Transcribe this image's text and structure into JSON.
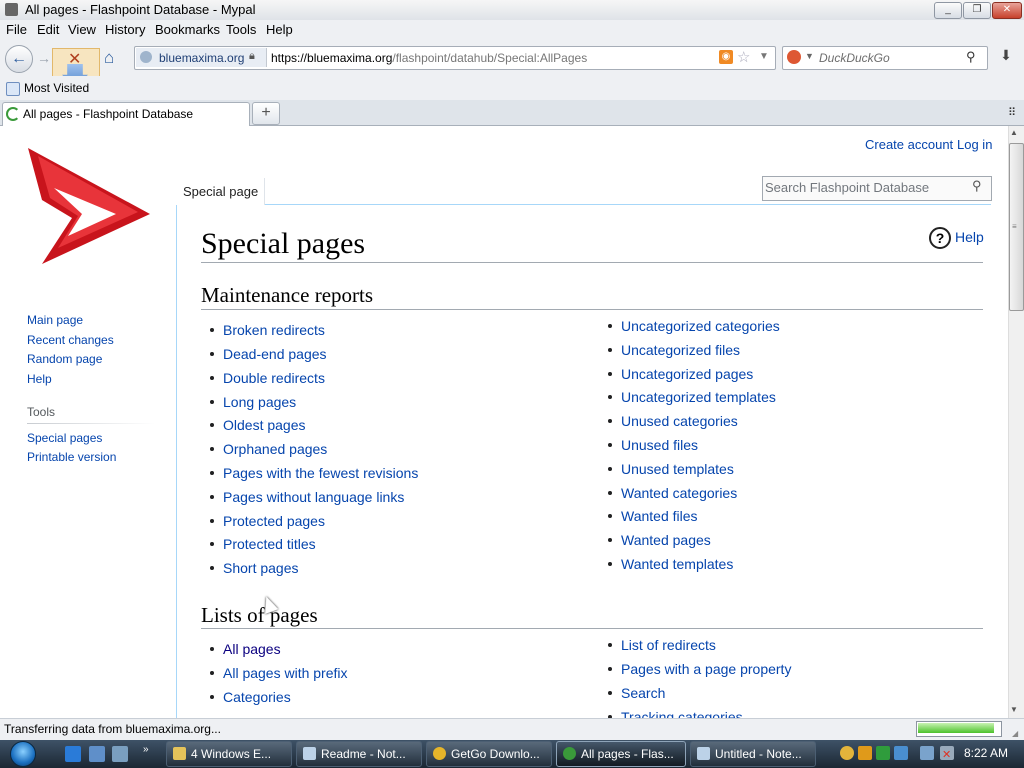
{
  "window": {
    "title": "All pages - Flashpoint Database - Mypal",
    "controls": [
      "_",
      "❐",
      "✕"
    ]
  },
  "menu": [
    "File",
    "Edit",
    "View",
    "History",
    "Bookmarks",
    "Tools",
    "Help"
  ],
  "navbar": {
    "site_identity": "bluemaxima.org",
    "url_host": "https://bluemaxima.org",
    "url_path": "/flashpoint/datahub/Special:AllPages",
    "search_placeholder": "DuckDuckGo"
  },
  "bookmarks": {
    "most_visited": "Most Visited"
  },
  "tabs": {
    "active_label": "All pages - Flashpoint Database",
    "new_tab": "+"
  },
  "page": {
    "personal": {
      "create_account": "Create account",
      "log_in": "Log in"
    },
    "tab_special": "Special page",
    "search_placeholder": "Search Flashpoint Database",
    "heading": "Special pages",
    "help": "Help",
    "sidebar": {
      "nav": [
        "Main page",
        "Recent changes",
        "Random page",
        "Help"
      ],
      "tools_heading": "Tools",
      "tools": [
        "Special pages",
        "Printable version"
      ]
    },
    "maintenance": {
      "title": "Maintenance reports",
      "left": [
        "Broken redirects",
        "Dead-end pages",
        "Double redirects",
        "Long pages",
        "Oldest pages",
        "Orphaned pages",
        "Pages with the fewest revisions",
        "Pages without language links",
        "Protected pages",
        "Protected titles",
        "Short pages"
      ],
      "right": [
        "Uncategorized categories",
        "Uncategorized files",
        "Uncategorized pages",
        "Uncategorized templates",
        "Unused categories",
        "Unused files",
        "Unused templates",
        "Wanted categories",
        "Wanted files",
        "Wanted pages",
        "Wanted templates"
      ]
    },
    "lists": {
      "title": "Lists of pages",
      "left": [
        "All pages",
        "All pages with prefix",
        "Categories"
      ],
      "right": [
        "List of redirects",
        "Pages with a page property",
        "Search",
        "Tracking categories"
      ]
    }
  },
  "status": {
    "text": "Transferring data from bluemaxima.org...",
    "progress": 0.95
  },
  "taskbar": {
    "tasks": [
      "4 Windows E...",
      "Readme - Not...",
      "GetGo Downlo...",
      "All pages - Flas...",
      "Untitled - Note..."
    ],
    "clock": "8:22 AM"
  },
  "colors": {
    "link": "#0645ad",
    "visited_link": "#0b0080",
    "accent": "#a7d7f9",
    "taskbar": "#2a3947"
  }
}
